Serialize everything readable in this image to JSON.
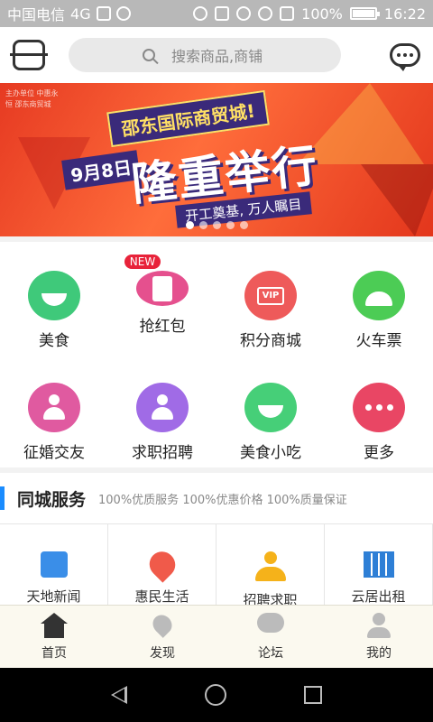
{
  "status_bar": {
    "carrier": "中国电信",
    "network": "4G",
    "battery": "100%",
    "battery_level": 1.0,
    "time": "16:22"
  },
  "header": {
    "search_placeholder": "搜索商品,商铺",
    "left_icon": "scan-icon",
    "right_icon": "message-icon"
  },
  "banner": {
    "side_text": "主办单位 中惠永恒 邵东商贸城",
    "title": "邵东国际商贸城!",
    "date": "9月8日",
    "headline": "隆重举行",
    "subtitle": "开工奠基, 万人瞩目",
    "slides": 5,
    "active_slide": 0
  },
  "categories": [
    {
      "label": "美食",
      "icon": "bowl-icon",
      "color": "#3fc97a",
      "badge": ""
    },
    {
      "label": "抢红包",
      "icon": "red-envelope-icon",
      "color": "#e5508e",
      "badge": "NEW"
    },
    {
      "label": "积分商城",
      "icon": "vip-card-icon",
      "color": "#ee5a5a",
      "badge": ""
    },
    {
      "label": "火车票",
      "icon": "train-icon",
      "color": "#4ccc55",
      "badge": ""
    },
    {
      "label": "征婚交友",
      "icon": "woman-icon",
      "color": "#e05aa0",
      "badge": ""
    },
    {
      "label": "求职招聘",
      "icon": "person-icon",
      "color": "#a06be6",
      "badge": ""
    },
    {
      "label": "美食小吃",
      "icon": "bowl-icon",
      "color": "#46cf78",
      "badge": ""
    },
    {
      "label": "更多",
      "icon": "more-icon",
      "color": "#e94664",
      "badge": ""
    }
  ],
  "section": {
    "title": "同城服务",
    "desc": "100%优质服务 100%优惠价格 100%质量保证"
  },
  "services": [
    {
      "label": "天地新闻",
      "icon": "news-icon",
      "color": "#3a8ee8"
    },
    {
      "label": "惠民生活",
      "icon": "location-heart-icon",
      "color": "#f05a4a"
    },
    {
      "label": "招聘求职",
      "icon": "person-icon",
      "color": "#f5b21a"
    },
    {
      "label": "云居出租",
      "icon": "building-icon",
      "color": "#2e7fd6"
    }
  ],
  "tabbar": [
    {
      "label": "首页",
      "icon": "home-icon",
      "active": true
    },
    {
      "label": "发现",
      "icon": "discover-icon",
      "active": false
    },
    {
      "label": "论坛",
      "icon": "forum-icon",
      "active": false
    },
    {
      "label": "我的",
      "icon": "profile-icon",
      "active": false
    }
  ],
  "colors": {
    "accent": "#1a8cff",
    "tab_active": "#333333",
    "tab_inactive": "#bbbbbb"
  }
}
